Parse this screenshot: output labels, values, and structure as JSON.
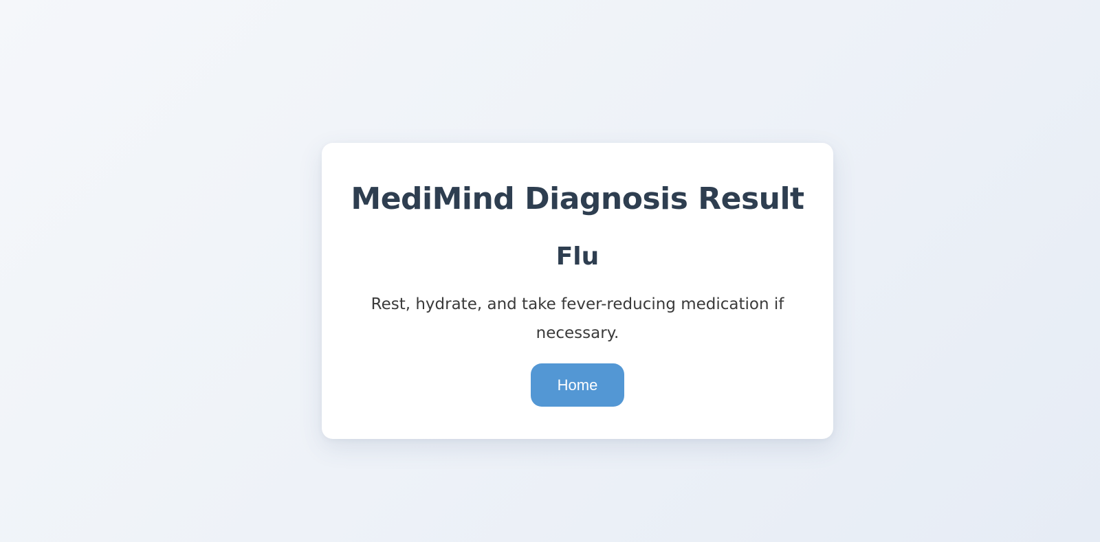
{
  "result": {
    "title": "MediMind Diagnosis Result",
    "diagnosis": "Flu",
    "advice": "Rest, hydrate, and take fever-reducing medication if necessary.",
    "home_label": "Home"
  },
  "colors": {
    "heading": "#2e3e50",
    "button": "#5397d4",
    "card": "#ffffff"
  }
}
